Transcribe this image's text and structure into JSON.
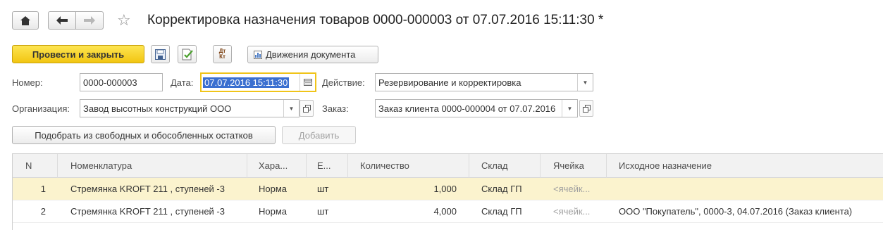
{
  "header": {
    "title": "Корректировка назначения товаров 0000-000003 от 07.07.2016 15:11:30 *"
  },
  "toolbar": {
    "post_close_label": "Провести и закрыть",
    "movements_label": "Движения документа",
    "dtkt_label": "Дт Кт"
  },
  "form": {
    "number_label": "Номер:",
    "number_value": "0000-000003",
    "date_label": "Дата:",
    "date_value": "07.07.2016 15:11:30",
    "action_label": "Действие:",
    "action_value": "Резервирование и корректировка",
    "org_label": "Организация:",
    "org_value": "Завод высотных конструкций ООО",
    "order_label": "Заказ:",
    "order_value": "Заказ клиента 0000-000004 от 07.07.2016"
  },
  "actions": {
    "pick_label": "Подобрать из свободных и обособленных остатков",
    "add_label": "Добавить"
  },
  "table": {
    "columns": [
      "N",
      "Номенклатура",
      "Хара...",
      "Е...",
      "Количество",
      "Склад",
      "Ячейка",
      "Исходное назначение"
    ],
    "rows": [
      {
        "n": "1",
        "item": "Стремянка KROFT 211 , ступеней -3",
        "char": "Норма",
        "unit": "шт",
        "qty": "1,000",
        "warehouse": "Склад ГП",
        "cell": "<ячейк...",
        "source": ""
      },
      {
        "n": "2",
        "item": "Стремянка KROFT 211 , ступеней -3",
        "char": "Норма",
        "unit": "шт",
        "qty": "4,000",
        "warehouse": "Склад ГП",
        "cell": "<ячейк...",
        "source": "ООО \"Покупатель\", 0000-3, 04.07.2016 (Заказ клиента)"
      }
    ]
  },
  "colors": {
    "primary_button": "#f2c511",
    "selected_row": "#fbf3ce",
    "date_focus": "#f0c419"
  }
}
